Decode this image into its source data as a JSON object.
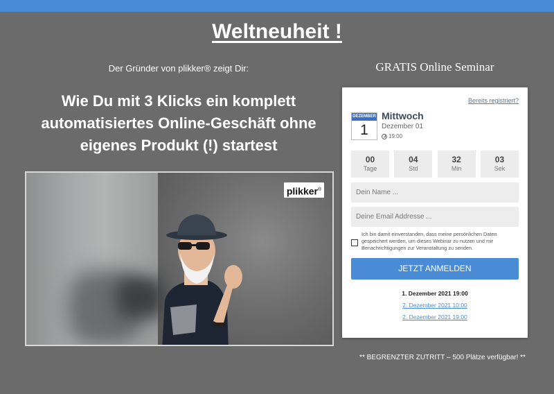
{
  "headline": "Weltneuheit !",
  "intro": "Der Gründer von plikker® zeigt Dir:",
  "main_heading": "Wie Du mit 3 Klicks ein komplett automatisiertes Online-Geschäft ohne eigenes Produkt (!) startest",
  "video": {
    "logo_text": "plikker",
    "logo_mark": "®"
  },
  "sidebar_title": "GRATIS Online Seminar",
  "card": {
    "already_registered": "Bereits registriert?",
    "calendar_month": "DEZEMBER",
    "calendar_day": "1",
    "weekday": "Mittwoch",
    "date": "Dezember 01",
    "time": "19:00",
    "countdown": [
      {
        "value": "00",
        "label": "Tage"
      },
      {
        "value": "04",
        "label": "Std"
      },
      {
        "value": "32",
        "label": "Min"
      },
      {
        "value": "03",
        "label": "Sek"
      }
    ],
    "name_placeholder": "Dein Name ...",
    "email_placeholder": "Deine Email Addresse ...",
    "consent_text": "Ich bin damit einverstanden, dass meine persönlichen Daten gespeichert werden, um dieses Webinar zu nutzen und mir Benachrichtigungen zur Veranstaltung zu senden.",
    "submit_label": "JETZT ANMELDEN",
    "date_options": [
      "1. Dezember 2021 19:00",
      "2. Dezember 2021 10:00",
      "2. Dezember 2021 19:00"
    ]
  },
  "footer_note": "** BEGRENZTER ZUTRITT – 500 Plätze verfügbar! **",
  "colors": {
    "background": "#6b6b6b",
    "accent": "#4a8bd6"
  }
}
